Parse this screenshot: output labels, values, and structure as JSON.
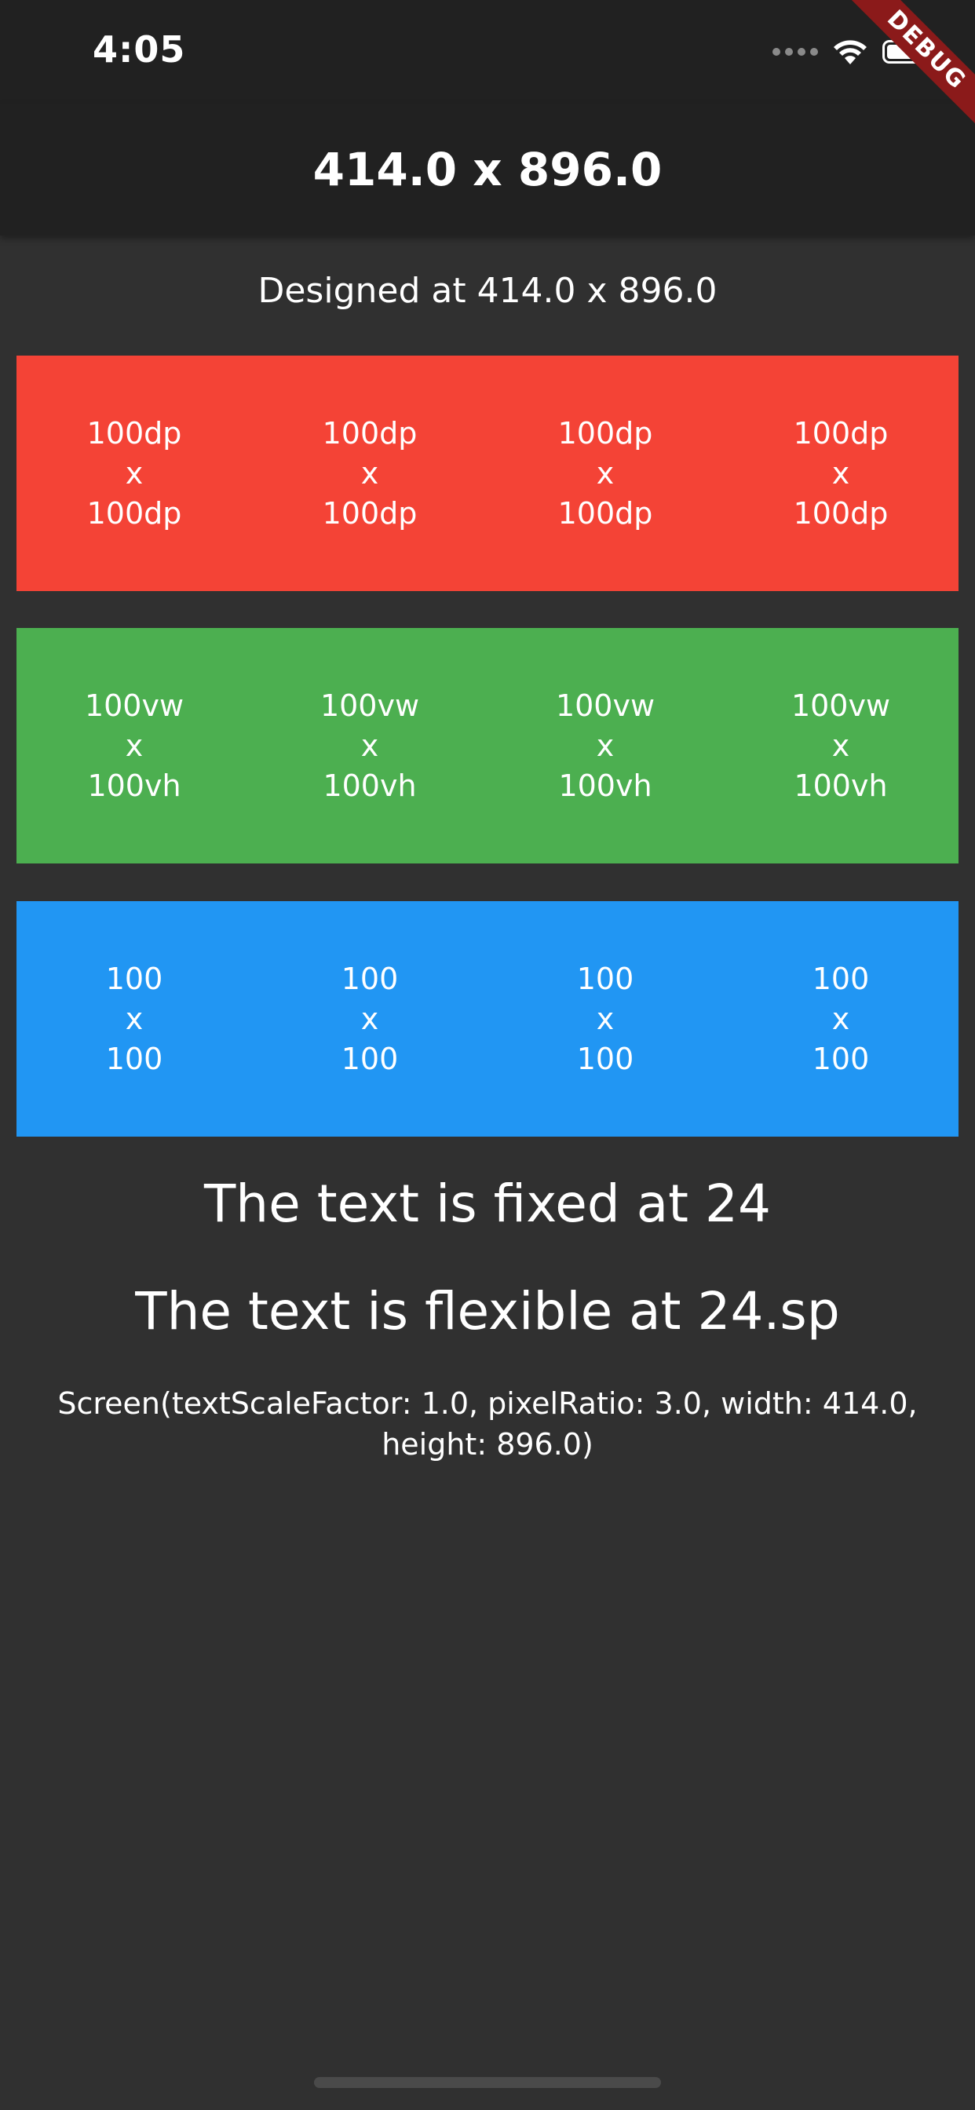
{
  "status_bar": {
    "time": "4:05",
    "icons": [
      "signal-dots-icon",
      "wifi-icon",
      "battery-icon"
    ]
  },
  "debug_banner": "DEBUG",
  "app_bar": {
    "title": "414.0 x 896.0"
  },
  "designed_text": "Designed at 414.0 x 896.0",
  "colors": {
    "background": "#303030",
    "app_bar": "#212121",
    "red": "#f44336",
    "green": "#4caf50",
    "blue": "#2196f3",
    "debug": "#8b1a1a"
  },
  "boxes": {
    "red": [
      {
        "w": "100dp",
        "x": "x",
        "h": "100dp"
      },
      {
        "w": "100dp",
        "x": "x",
        "h": "100dp"
      },
      {
        "w": "100dp",
        "x": "x",
        "h": "100dp"
      },
      {
        "w": "100dp",
        "x": "x",
        "h": "100dp"
      }
    ],
    "green": [
      {
        "w": "100vw",
        "x": "x",
        "h": "100vh"
      },
      {
        "w": "100vw",
        "x": "x",
        "h": "100vh"
      },
      {
        "w": "100vw",
        "x": "x",
        "h": "100vh"
      },
      {
        "w": "100vw",
        "x": "x",
        "h": "100vh"
      }
    ],
    "blue": [
      {
        "w": "100",
        "x": "x",
        "h": "100"
      },
      {
        "w": "100",
        "x": "x",
        "h": "100"
      },
      {
        "w": "100",
        "x": "x",
        "h": "100"
      },
      {
        "w": "100",
        "x": "x",
        "h": "100"
      }
    ]
  },
  "fixed_text": "The text is fixed at 24",
  "flexible_text": "The text is flexible at 24.sp",
  "screen_info": "Screen(textScaleFactor: 1.0, pixelRatio: 3.0, width: 414.0, height: 896.0)"
}
